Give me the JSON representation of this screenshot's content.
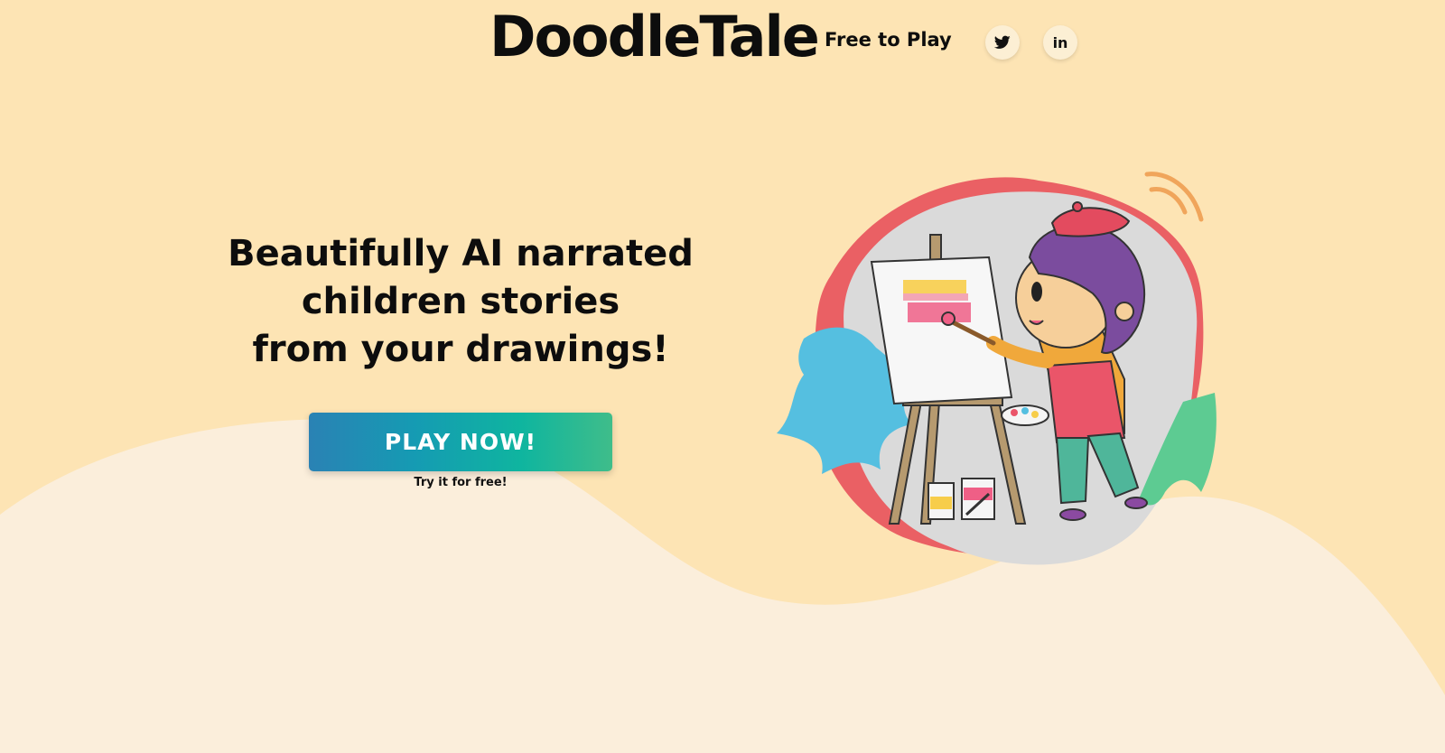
{
  "header": {
    "logo": "DoodleTale",
    "nav_link": "Free to Play",
    "social": [
      {
        "name": "twitter-icon",
        "glyph": "𝕏"
      },
      {
        "name": "linkedin-icon",
        "glyph": "in"
      }
    ]
  },
  "hero": {
    "title_lines": [
      "Beautifully AI narrated",
      "children stories",
      "from your drawings!"
    ],
    "cta_label": "PLAY NOW!",
    "cta_subtext": "Try it for free!"
  },
  "colors": {
    "background": "#fde4b4",
    "wave": "#fbeedb",
    "accent_teal": "#0fb59f",
    "accent_blue": "#2a82b4",
    "blob_red": "#ea6064",
    "blob_grey": "#dcdcdc"
  }
}
